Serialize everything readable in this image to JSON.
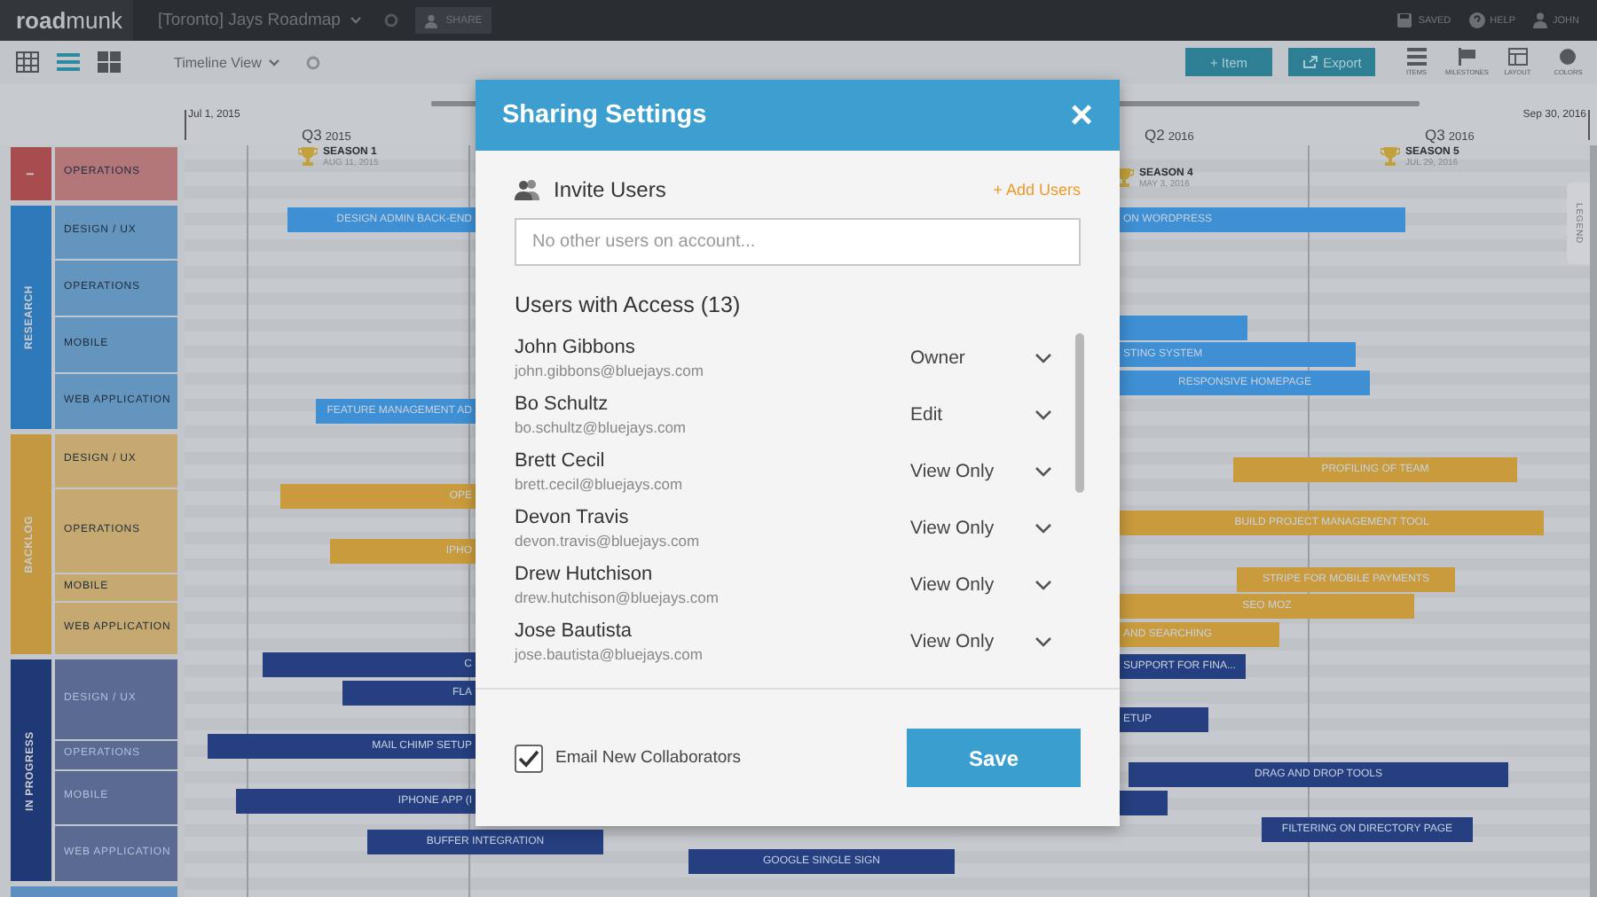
{
  "topbar": {
    "logo": "**road**munk",
    "roadmap_title": "[Toronto] Jays Roadmap",
    "share": "SHARE",
    "status": [
      {
        "kind": "save",
        "label": "SAVED"
      },
      {
        "kind": "help",
        "label": "HELP"
      },
      {
        "kind": "user",
        "label": "JOHN"
      }
    ]
  },
  "toolbar": {
    "views": [
      {
        "kind": "table",
        "selected": false
      },
      {
        "kind": "timeline",
        "selected": true
      },
      {
        "kind": "board",
        "selected": false
      }
    ],
    "view_menu": "Timeline View",
    "add_item": "+ Item",
    "export": "Export",
    "tools": [
      {
        "kind": "items",
        "label": "ITEMS"
      },
      {
        "kind": "milestones",
        "label": "MILESTONES"
      },
      {
        "kind": "layout",
        "label": "LAYOUT"
      },
      {
        "kind": "colors",
        "label": "COLORS"
      }
    ]
  },
  "timeline": {
    "start_date": "Jul 1, 2015",
    "end_date": "Sep 30, 2016",
    "quarters": [
      {
        "label": "Q3",
        "year": "2015"
      },
      {
        "label": "Q2",
        "year": "2016"
      },
      {
        "label": "Q3",
        "year": "2016"
      }
    ],
    "milestones": [
      {
        "name": "SEASON 1",
        "date": "AUG 11, 2015"
      },
      {
        "name": "SEASON 4",
        "date": "MAY 3, 2016"
      },
      {
        "name": "SEASON 5",
        "date": "JUL 29, 2016"
      }
    ],
    "groups": [
      {
        "label": "I",
        "color": "#a84c50",
        "lanes": [
          "OPERATIONS"
        ]
      },
      {
        "label": "RESEARCH",
        "color": "#2e79b9",
        "lanes": [
          "DESIGN / UX",
          "OPERATIONS",
          "MOBILE",
          "WEB APPLICATION"
        ]
      },
      {
        "label": "BACKLOG",
        "color": "#c39840",
        "lanes": [
          "DESIGN / UX",
          "OPERATIONS",
          "MOBILE",
          "WEB APPLICATION"
        ]
      },
      {
        "label": "IN PROGRESS",
        "color": "#1f3876",
        "lanes": [
          "DESIGN / UX",
          "OPERATIONS",
          "MOBILE",
          "WEB APPLICATION"
        ]
      }
    ],
    "bars": [
      {
        "text": "DESIGN ADMIN BACK-END",
        "color": "#3f8fd4"
      },
      {
        "text": "ON WORDPRESS",
        "color": "#3f8fd4"
      },
      {
        "color": "#3f8fd4"
      },
      {
        "text": "STING SYSTEM",
        "color": "#3f8fd4"
      },
      {
        "text": "RESPONSIVE HOMEPAGE",
        "color": "#3f8fd4"
      },
      {
        "text": "FEATURE MANAGEMENT AD",
        "color": "#3f8fd4"
      },
      {
        "text": "PROFILING OF TEAM",
        "color": "#c99b3c"
      },
      {
        "text": "OPE",
        "color": "#c99b3c"
      },
      {
        "text": "BUILD PROJECT MANAGEMENT TOOL",
        "color": "#c99b3c"
      },
      {
        "text": "IPHO",
        "color": "#c99b3c"
      },
      {
        "text": "STRIPE FOR MOBILE PAYMENTS",
        "color": "#c99b3c"
      },
      {
        "text": "SEO MOZ",
        "color": "#c99b3c"
      },
      {
        "text": "AND SEARCHING",
        "color": "#c99b3c"
      },
      {
        "text": "C",
        "color": "#253f80"
      },
      {
        "text": "SUPPORT FOR FINA...",
        "color": "#253f80"
      },
      {
        "text": "FLA",
        "color": "#253f80"
      },
      {
        "text": "ETUP",
        "color": "#253f80"
      },
      {
        "text": "MAIL CHIMP SETUP",
        "color": "#253f80"
      },
      {
        "text": "DRAG AND DROP TOOLS",
        "color": "#253f80"
      },
      {
        "text": "IPHONE APP (I",
        "color": "#253f80"
      },
      {
        "color": "#253f80"
      },
      {
        "text": "BUFFER INTEGRATION",
        "color": "#253f80"
      },
      {
        "text": "FILTERING ON DIRECTORY PAGE",
        "color": "#253f80"
      },
      {
        "text": "GOOGLE SINGLE SIGN",
        "color": "#253f80"
      }
    ],
    "legend": "LEGEND"
  },
  "modal": {
    "title": "Sharing Settings",
    "close": "×",
    "invite_label": "Invite Users",
    "add_users": "+ Add Users",
    "invite_placeholder": "No other users on account...",
    "access_heading": "Users with Access (13)",
    "users": [
      {
        "name": "John Gibbons",
        "email": "john.gibbons@bluejays.com",
        "role": "Owner"
      },
      {
        "name": "Bo Schultz",
        "email": "bo.schultz@bluejays.com",
        "role": "Edit"
      },
      {
        "name": "Brett Cecil",
        "email": "brett.cecil@bluejays.com",
        "role": "View Only"
      },
      {
        "name": "Devon Travis",
        "email": "devon.travis@bluejays.com",
        "role": "View Only"
      },
      {
        "name": "Drew Hutchison",
        "email": "drew.hutchison@bluejays.com",
        "role": "View Only"
      },
      {
        "name": "Jose Bautista",
        "email": "jose.bautista@bluejays.com",
        "role": "View Only"
      }
    ],
    "email_collaborators": {
      "label": "Email New Collaborators",
      "checked": true
    },
    "save": "Save"
  }
}
